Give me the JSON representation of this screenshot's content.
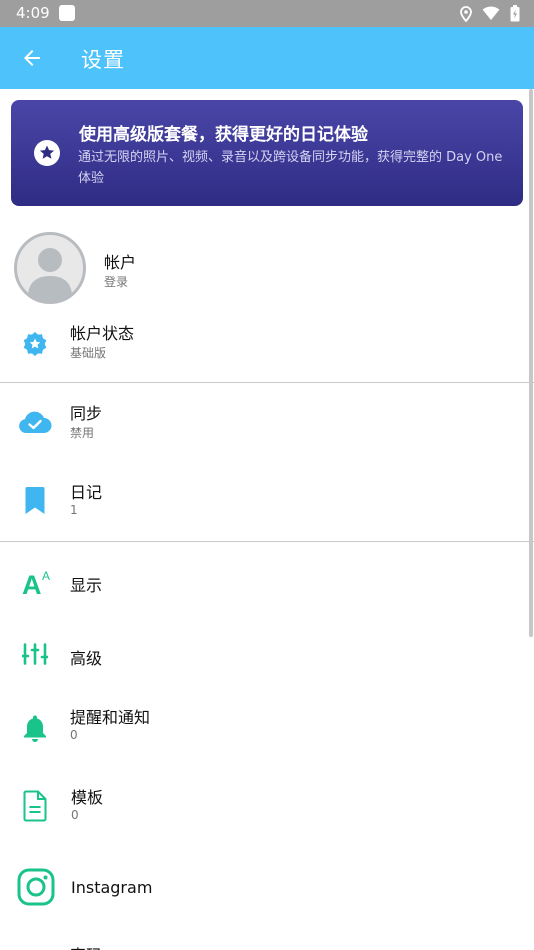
{
  "status_bar": {
    "time": "4:09"
  },
  "app_bar": {
    "title": "设置"
  },
  "promo": {
    "title": "使用高级版套餐，获得更好的日记体验",
    "subtitle": "通过无限的照片、视频、录音以及跨设备同步功能，获得完整的 Day One 体验"
  },
  "account": {
    "label": "帐户",
    "sub": "登录"
  },
  "account_status": {
    "label": "帐户状态",
    "sub": "基础版"
  },
  "sync": {
    "label": "同步",
    "sub": "禁用"
  },
  "journals": {
    "label": "日记",
    "sub": "1"
  },
  "display": {
    "label": "显示"
  },
  "advanced": {
    "label": "高级"
  },
  "reminders": {
    "label": "提醒和通知",
    "sub": "0"
  },
  "templates": {
    "label": "模板",
    "sub": "0"
  },
  "instagram": {
    "label": "Instagram"
  },
  "passcode": {
    "label": "密码"
  },
  "colors": {
    "app_bar": "#4dc2fb",
    "promo_start": "#4a46a8",
    "promo_end": "#2f2c84",
    "blue_icon": "#3fb6f0",
    "green_icon": "#19c389"
  }
}
